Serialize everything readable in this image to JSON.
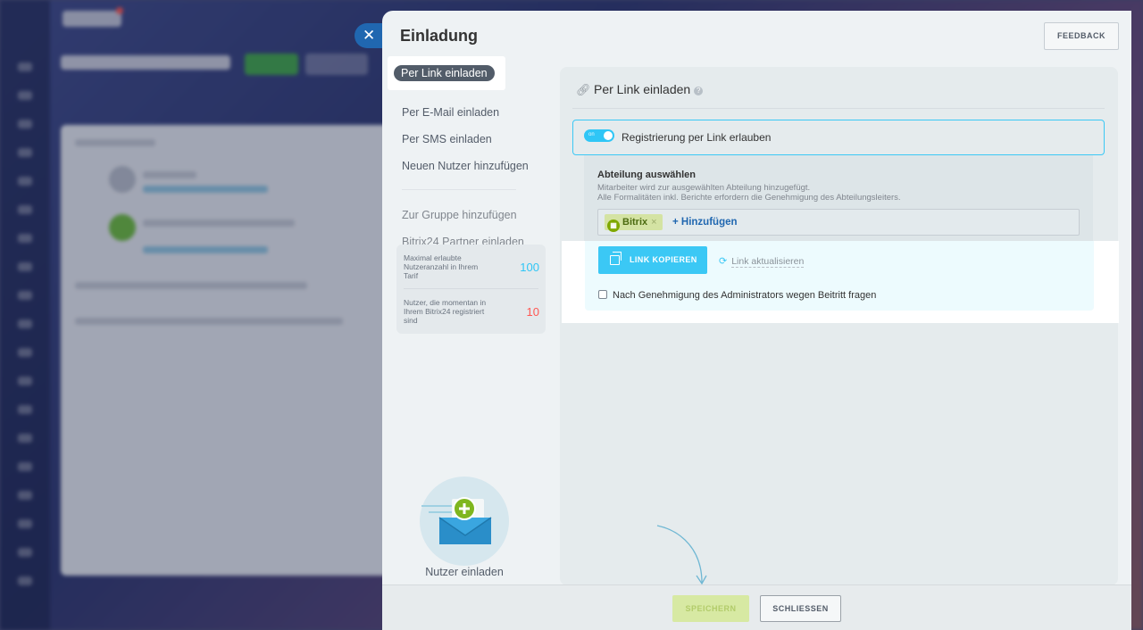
{
  "slider": {
    "close_icon": "✕",
    "title": "Einladung",
    "feedback_label": "FEEDBACK"
  },
  "menu": {
    "active": "Per Link einladen",
    "items": [
      "Per E-Mail einladen",
      "Per SMS einladen",
      "Neuen Nutzer hinzufügen"
    ],
    "extra_items": [
      "Zur Gruppe hinzufügen",
      "Bitrix24 Partner einladen"
    ]
  },
  "stats": {
    "max_label": "Maximal erlaubte Nutzeranzahl in Ihrem Tarif",
    "max_value": "100",
    "max_color": "#2fc6f6",
    "current_label": "Nutzer, die momentan in Ihrem Bitrix24 registriert sind",
    "current_value": "10",
    "current_color": "#ff5752"
  },
  "illustration": {
    "icon": "envelope-add-icon",
    "caption": "Nutzer einladen"
  },
  "card": {
    "title": "Per Link einladen",
    "help_icon": "?",
    "toggle_state": "on",
    "toggle_label": "Registrierung per Link erlauben",
    "department_title": "Abteilung auswählen",
    "department_desc_1": "Mitarbeiter wird zur ausgewählten Abteilung hinzugefügt.",
    "department_desc_2": "Alle Formalitäten inkl. Berichte erfordern die Genehmigung des Abteilungsleiters.",
    "tag_label": "Bitrix",
    "tag_remove": "×",
    "add_label": "+ Hinzufügen",
    "copy_label": "LINK KOPIEREN",
    "refresh_label": "Link aktualisieren",
    "approval_label": "Nach Genehmigung des Administrators wegen Beitritt fragen",
    "approval_checked": false
  },
  "footer": {
    "save_label": "SPEICHERN",
    "close_label": "SCHLIESSEN"
  },
  "colors": {
    "accent": "#3bc8f5",
    "link": "#2067b0",
    "save": "#bbed21"
  }
}
